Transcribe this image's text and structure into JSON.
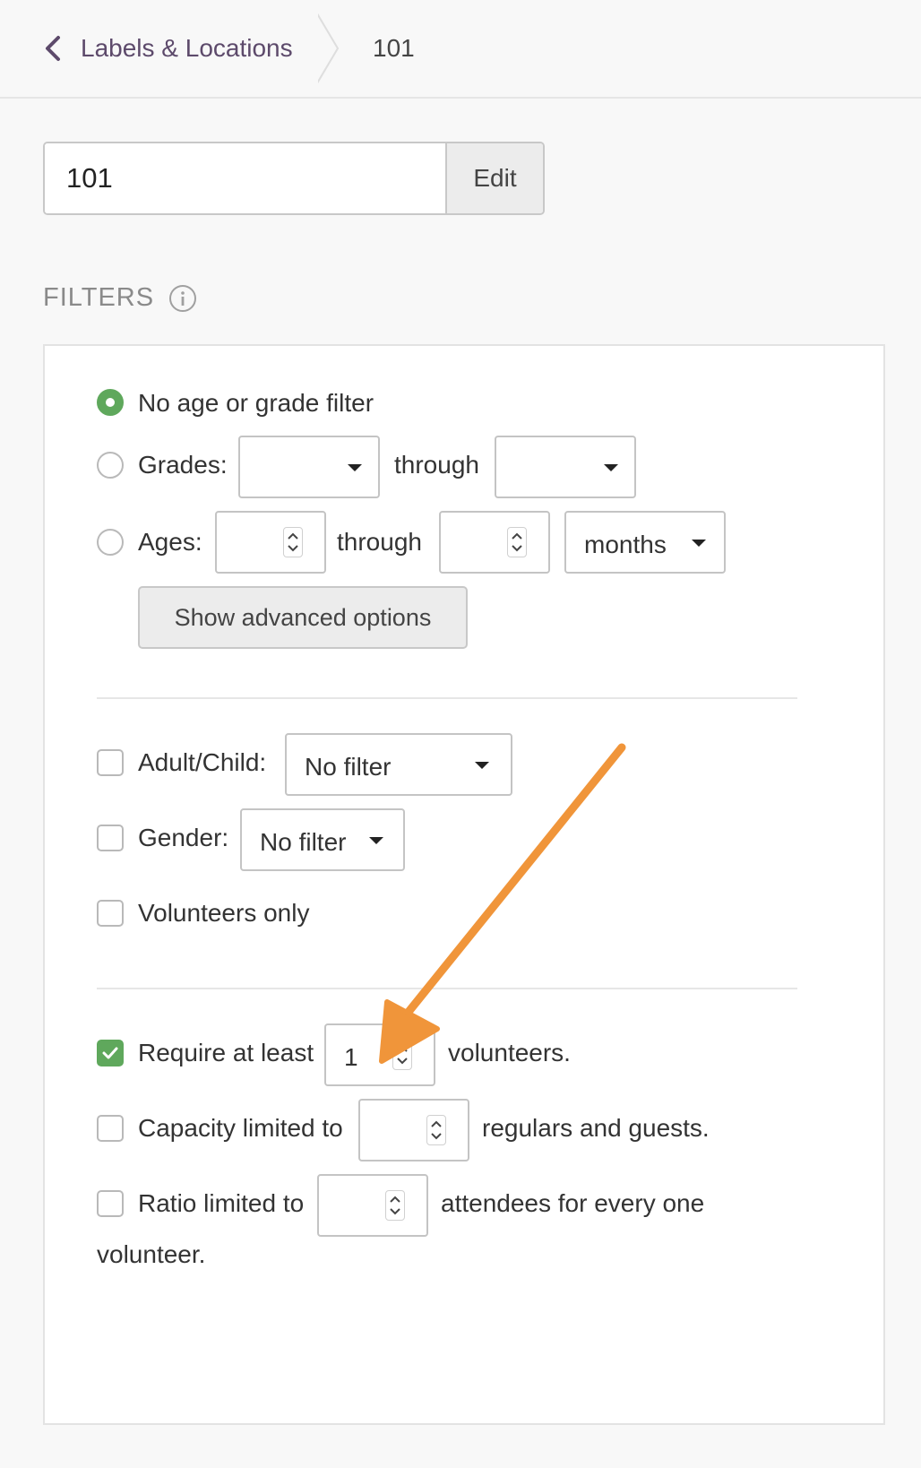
{
  "breadcrumb": {
    "back_label": "Labels & Locations",
    "current": "101"
  },
  "name_field": {
    "value": "101",
    "edit_label": "Edit"
  },
  "filters": {
    "title": "FILTERS",
    "age_grade": {
      "none_label": "No age or grade filter",
      "grades_label": "Grades:",
      "grades_through": "through",
      "ages_label": "Ages:",
      "ages_through": "through",
      "age_unit": "months",
      "advanced_button": "Show advanced options",
      "selected": "none"
    },
    "adult_child": {
      "label": "Adult/Child:",
      "value": "No filter",
      "checked": false
    },
    "gender": {
      "label": "Gender:",
      "value": "No filter",
      "checked": false
    },
    "volunteers_only": {
      "label": "Volunteers only",
      "checked": false
    },
    "require_volunteers": {
      "label_before": "Require at least",
      "value": "1",
      "label_after": "volunteers.",
      "checked": true
    },
    "capacity": {
      "label_before": "Capacity limited to",
      "value": "",
      "label_after": "regulars and guests.",
      "checked": false
    },
    "ratio": {
      "label_before": "Ratio limited to",
      "value": "",
      "label_after": "attendees for every one",
      "label_wrap": "volunteer.",
      "checked": false
    }
  },
  "colors": {
    "accent_green": "#5fa85c",
    "breadcrumb_purple": "#5d4a6b",
    "annotation_arrow": "#f0953a"
  }
}
